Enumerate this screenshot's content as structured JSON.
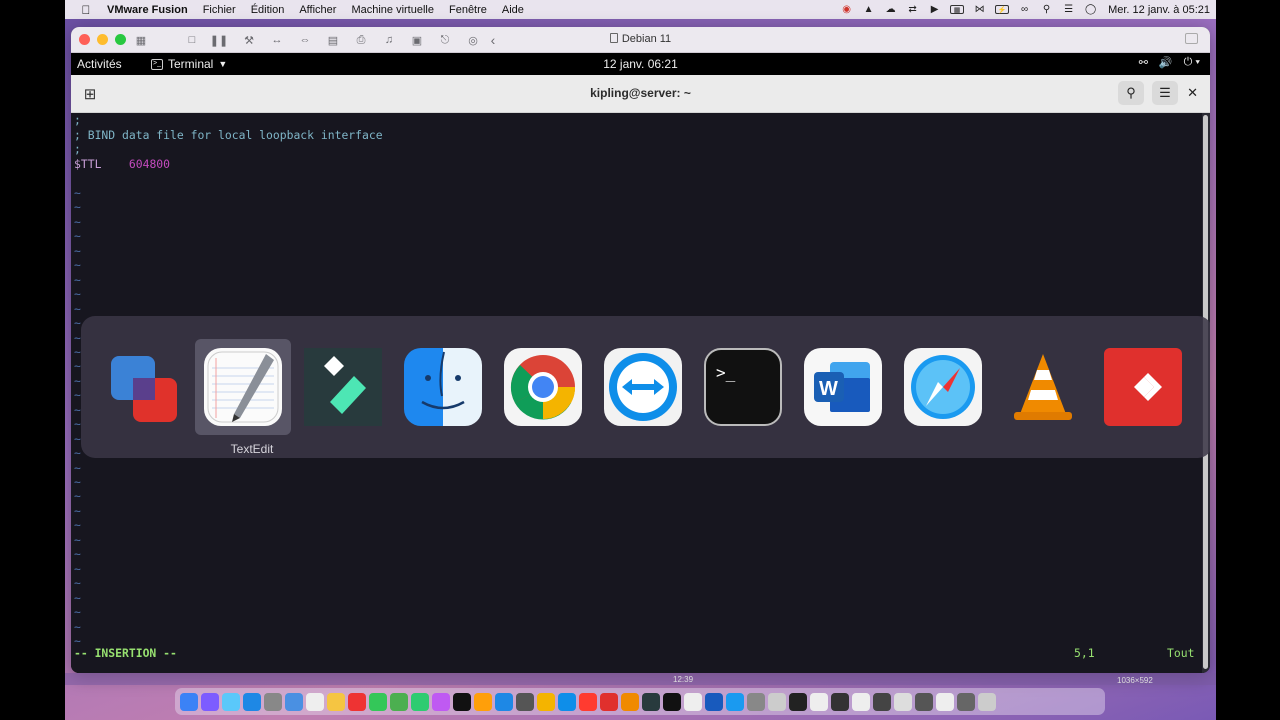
{
  "mac_menubar": {
    "app_name": "VMware Fusion",
    "menus": [
      "Fichier",
      "Édition",
      "Afficher",
      "Machine virtuelle",
      "Fenêtre",
      "Aide"
    ],
    "clock": "Mer. 12 janv. à  05:21",
    "tray_icons": [
      "record-icon",
      "cone-icon",
      "cloud-icon",
      "teamviewer-icon",
      "play-icon",
      "ram-icon",
      "bluetooth-icon",
      "battery-icon",
      "link-icon",
      "search-icon",
      "control-center-icon",
      "siri-icon"
    ]
  },
  "vmware_window": {
    "title": "Debian 11",
    "toolbar_icons": [
      "snapshot-icon",
      "stop-icon",
      "pause-icon",
      "settings-icon",
      "shared-icon",
      "network-icon",
      "disk-icon",
      "printer-icon",
      "sound-icon",
      "camera-icon",
      "usb-icon",
      "cd-icon",
      "back-icon"
    ]
  },
  "gnome": {
    "activities": "Activités",
    "app_menu": "Terminal",
    "clock": "12 janv.  06:21"
  },
  "terminal": {
    "title": "kipling@server: ~",
    "lines": [
      {
        "cls": "c-comment",
        "text": ";"
      },
      {
        "cls": "c-comment",
        "text": "; BIND data file for local loopback interface"
      },
      {
        "cls": "c-comment",
        "text": ";"
      },
      {
        "cls": "c-key",
        "text": "$TTL"
      }
    ],
    "ttl_value": "604800",
    "mode": "-- INSERTION --",
    "position": "5,1",
    "scroll": "Tout"
  },
  "app_switcher": {
    "selected_label": "TextEdit",
    "apps": [
      {
        "name": "vmware-fusion",
        "icon": "vmware-icon"
      },
      {
        "name": "textedit",
        "icon": "textedit-icon"
      },
      {
        "name": "filmora",
        "icon": "filmora-icon"
      },
      {
        "name": "finder",
        "icon": "finder-icon"
      },
      {
        "name": "chrome",
        "icon": "chrome-icon"
      },
      {
        "name": "teamviewer",
        "icon": "teamviewer-icon"
      },
      {
        "name": "terminal",
        "icon": "terminal-icon"
      },
      {
        "name": "word",
        "icon": "word-icon"
      },
      {
        "name": "safari",
        "icon": "safari-icon"
      },
      {
        "name": "vlc",
        "icon": "vlc-icon"
      },
      {
        "name": "anydesk",
        "icon": "anydesk-icon"
      }
    ]
  },
  "dock_strip": {
    "time": "12:39",
    "dims": "1036×592"
  },
  "colors": {
    "terminal_bg": "#17161f",
    "comment": "#7fb5c7",
    "number": "#c44bbf",
    "status_green": "#97e070",
    "tilde": "#4c6fa8"
  }
}
